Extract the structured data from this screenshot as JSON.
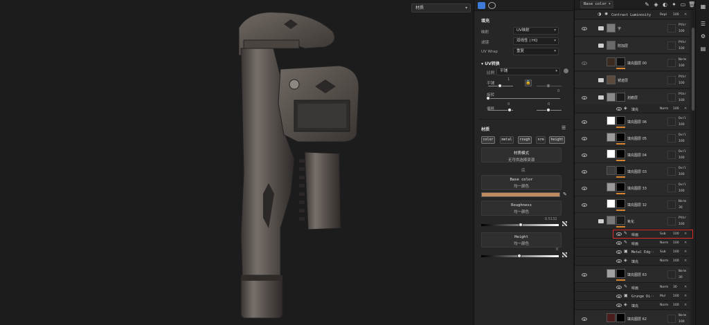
{
  "viewport": {
    "dropdown_label": "材质"
  },
  "properties": {
    "fill_section": "填充",
    "projection_label": "映射",
    "projection_value": "UV映射",
    "filter_label": "滤镜",
    "filter_value": "双线性 | HQ",
    "uvwrap_label": "UV Wrap",
    "uvwrap_value": "重复",
    "uv_transform_title": "UV转换",
    "scale_label": "比例",
    "scale_value": "平铺",
    "tile_label": "平铺",
    "tile_value": "1",
    "rotate_label": "旋转",
    "rotate_value": "0",
    "offset_label": "偏移",
    "offset_value_1": "0",
    "offset_value_2": "0",
    "material_section": "材质",
    "channels": [
      "color",
      "metal",
      "rough",
      "nrm",
      "height"
    ],
    "material_mode_title": "材质模式",
    "material_mode_sub": "无可供选择资源",
    "base_label": "底",
    "base_color_title": "Base color",
    "base_color_sub": "均一颜色",
    "base_color_hex": "#c08a5f",
    "roughness_title": "Roughness",
    "roughness_sub": "均一颜色",
    "roughness_value": "0.5132",
    "height_title": "Height",
    "height_sub": "均一颜色",
    "height_value": "0"
  },
  "layers": {
    "channel_select": "Base color",
    "top_row_name": "Contrast Luminosity",
    "top_row_blend": "Repl",
    "top_row_opacity": "100",
    "rows": [
      {
        "name": "字",
        "blend": "Pthr",
        "opacity": "100",
        "kind": "folder"
      },
      {
        "name": "附加层",
        "blend": "Pthr",
        "opacity": "100",
        "kind": "folder"
      },
      {
        "name": "填充图层 00",
        "blend": "Norm",
        "opacity": "100",
        "kind": "layer"
      },
      {
        "name": "锈迹层",
        "blend": "Pthr",
        "opacity": "100",
        "kind": "folder"
      },
      {
        "name": "划痕层",
        "blend": "Pthr",
        "opacity": "100",
        "kind": "folder"
      },
      {
        "name": "填充图层 06",
        "blend": "Ovrl",
        "opacity": "100",
        "kind": "layer"
      },
      {
        "name": "填充图层 05",
        "blend": "Ovrl",
        "opacity": "100",
        "kind": "layer"
      },
      {
        "name": "填充图层 04",
        "blend": "Ovrl",
        "opacity": "100",
        "kind": "layer"
      },
      {
        "name": "填充图层 03",
        "blend": "Ovrl",
        "opacity": "100",
        "kind": "layer"
      },
      {
        "name": "填充图层 33",
        "blend": "Ovrl",
        "opacity": "100",
        "kind": "layer"
      },
      {
        "name": "填充图层 32",
        "blend": "Norm",
        "opacity": "30",
        "kind": "layer"
      },
      {
        "name": "氧化",
        "blend": "Pthr",
        "opacity": "100",
        "kind": "folder"
      },
      {
        "name": "填充图层 63",
        "blend": "Norm",
        "opacity": "30",
        "kind": "layer"
      },
      {
        "name": "填充图层 62",
        "blend": "Norm",
        "opacity": "100",
        "kind": "layer"
      }
    ],
    "fx_fill_1": {
      "name": "填充",
      "blend": "Norm",
      "opacity": "100"
    },
    "fx_group_oxid": [
      {
        "name": "绘画",
        "blend": "Sub",
        "opacity": "100"
      },
      {
        "name": "绘画",
        "blend": "Norm",
        "opacity": "100"
      },
      {
        "name": "Metal Edg··",
        "blend": "Sub",
        "opacity": "100"
      },
      {
        "name": "填充",
        "blend": "Norm",
        "opacity": "100"
      }
    ],
    "fx_group_63": [
      {
        "name": "绘画",
        "blend": "Norm",
        "opacity": "30"
      },
      {
        "name": "Grunge Di··",
        "blend": "Mul",
        "opacity": "100"
      },
      {
        "name": "填充",
        "blend": "Norm",
        "opacity": "100"
      }
    ]
  }
}
